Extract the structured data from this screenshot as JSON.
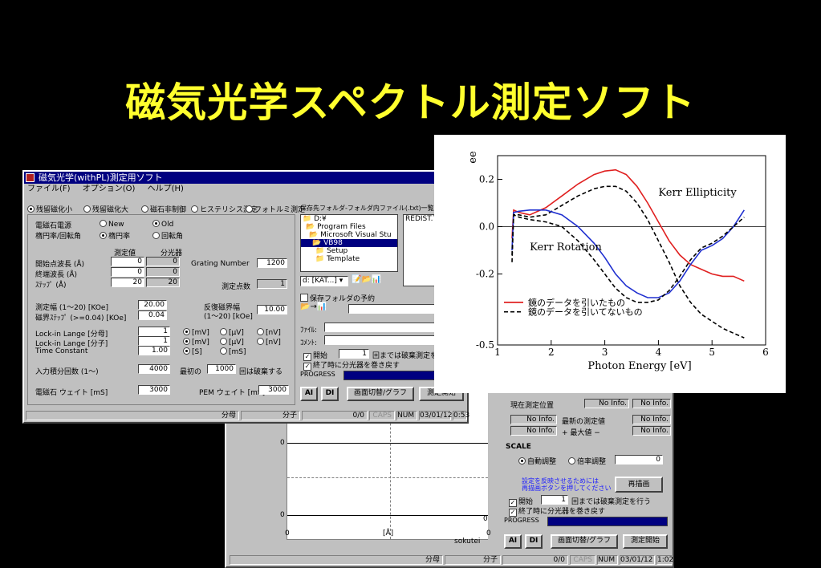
{
  "slide_title": "磁気光学スペクトル測定ソフト",
  "main_window": {
    "title": "磁気光学(withPL)測定用ソフト",
    "close": "×",
    "menu": [
      "ファイル(F)",
      "オプション(O)",
      "ヘルプ(H)"
    ],
    "mode_radios": [
      "残留磁化小",
      "残留磁化大",
      "磁石非制御",
      "ヒステリシス測定",
      "フォトルミ測定"
    ],
    "magnet_label": "電磁石電源",
    "magnet_new": "New",
    "magnet_old": "Old",
    "ellip_label": "楕円率/回転角",
    "ellip_opt": "楕円率",
    "rot_opt": "回転角",
    "col_measured": "測定値",
    "col_spectro": "分光器",
    "start_wl_label": "開始点波長 (Å)",
    "start_wl": "0",
    "start_wl2": "0",
    "end_wl_label": "終端波長 (Å)",
    "end_wl": "0",
    "end_wl2": "0",
    "step_label": "ｽﾃｯﾌﾟ (Å)",
    "step": "20",
    "step2": "20",
    "grating_label": "Grating Number",
    "grating": "1200",
    "points_label": "測定点数",
    "points": "1",
    "width_label": "測定幅 (1～20) [KOe]",
    "width": "20.00",
    "field_step_label": "磁界ｽﾃｯﾌﾟ (>=0.04) [KOe]",
    "field_step": "0.04",
    "reverse_label": "反復磁界幅",
    "reverse_range": "(1～20) [kOe]",
    "reverse_val": "10.00",
    "lockin1_label": "Lock-in Lange [分母]",
    "lockin1": "1",
    "lockin2_label": "Lock-in Lange [分子]",
    "lockin2": "1",
    "tc_label": "Time Constant",
    "tc": "1.00",
    "unit_mv": "[mV]",
    "unit_uv": "[μV]",
    "unit_nv": "[nV]",
    "unit_s": "[S]",
    "unit_ms": "[mS]",
    "integ_label": "入力積分回数 (1～)",
    "integ": "4000",
    "first_label": "最初の",
    "first_val": "1000",
    "first_suffix": "回は破棄する",
    "wait_label": "電磁石 ウェイト [mS]",
    "wait": "3000",
    "pem_label": "PEM ウェイト [mS]",
    "pem": "3000",
    "folder_header": "保存先フォルダ-フォルダ内ファイル(.txt)一覧",
    "tree": [
      "D:¥",
      "Program Files",
      "Microsoft Visual Stu",
      "VB98",
      "Setup",
      "Template"
    ],
    "file_list": [
      "REDIST.TXT"
    ],
    "drive": "d: [KAT...]",
    "reserve_label": "保存フォルダの予約",
    "file_label": "ﾌｧｲﾙ:",
    "file_btn": "目",
    "comment_label": "ｺﾒﾝﾄ:",
    "begin_label": "開始",
    "begin_val": "1",
    "begin_suffix": "回までは破棄測定を行う",
    "return_label": "終了時に分光器を巻き戻す",
    "progress_label": "PROGRESS",
    "btn_ai": "AI",
    "btn_di": "DI",
    "btn_switch": "画面切替/グラフ",
    "btn_start": "測定開始",
    "status": [
      "分母",
      "分子",
      "0/0",
      "CAPS",
      "NUM",
      "03/01/12",
      "0:53"
    ]
  },
  "back_window": {
    "pos_label": "現在測定位置",
    "no_info": "No Info.",
    "latest_label": "最新の測定値",
    "max_label": "+ 最大値 −",
    "scale_label": "SCALE",
    "auto_label": "自動調整",
    "ratio_label": "倍率調整",
    "ratio_val": "0",
    "hint1": "設定を反映させるためには",
    "hint2": "再描画ボタンを押してください",
    "redraw": "再描画",
    "begin_label": "開始",
    "begin_val": "1",
    "begin_suffix": "回までは破棄測定を行う",
    "return_label": "終了時に分光器を巻き戻す",
    "progress_label": "PROGRESS",
    "btn_ai": "AI",
    "btn_di": "DI",
    "btn_switch": "画面切替/グラフ",
    "btn_start": "測定開始",
    "y_zero_top": "0",
    "y_zero_bottom": "0",
    "x_left": "0",
    "x_unit": "[Å]",
    "right_zero": "0",
    "right_zero2": "0",
    "sokutei": "sokutei",
    "status": [
      "分母",
      "分子",
      "0/0",
      "CAPS",
      "NUM",
      "03/01/12",
      "1:02"
    ]
  },
  "chart_data": {
    "type": "line",
    "xlabel": "Photon Energy [eV]",
    "ylabel_fragment": "ee",
    "xlim": [
      1,
      6
    ],
    "ylim": [
      -0.5,
      0.3
    ],
    "x_ticks": [
      "1",
      "2",
      "3",
      "4",
      "5",
      "6"
    ],
    "y_ticks": [
      "0.2",
      "0.0",
      "-0.2",
      "-0.5"
    ],
    "annotations": [
      "Kerr Ellipticity",
      "Kerr Rotation"
    ],
    "legend": [
      "鏡のデータを引いたもの",
      "鏡のデータを引いてないもの"
    ],
    "colors": {
      "red": "#e02020",
      "blue": "#2030d0",
      "black": "#000000"
    },
    "series": [
      {
        "name": "ellipticity_subtracted",
        "style": "solid",
        "color": "#e02020",
        "x": [
          1.27,
          1.3,
          1.4,
          1.6,
          1.9,
          2.2,
          2.5,
          2.8,
          3.0,
          3.2,
          3.4,
          3.6,
          3.8,
          4.0,
          4.2,
          4.4,
          4.6,
          4.8,
          5.0,
          5.2,
          5.4,
          5.6
        ],
        "y": [
          -0.05,
          0.07,
          0.06,
          0.05,
          0.08,
          0.13,
          0.18,
          0.22,
          0.235,
          0.24,
          0.22,
          0.17,
          0.1,
          0.02,
          -0.06,
          -0.12,
          -0.16,
          -0.18,
          -0.2,
          -0.21,
          -0.21,
          -0.23
        ]
      },
      {
        "name": "ellipticity_raw",
        "style": "dashed",
        "color": "#000000",
        "x": [
          1.27,
          1.3,
          1.4,
          1.6,
          1.9,
          2.2,
          2.5,
          2.8,
          3.0,
          3.2,
          3.4,
          3.6,
          3.8,
          4.0,
          4.2,
          4.4,
          4.6,
          4.8,
          5.0,
          5.2,
          5.4,
          5.6
        ],
        "y": [
          -0.15,
          0.05,
          0.05,
          0.04,
          0.05,
          0.09,
          0.13,
          0.16,
          0.17,
          0.17,
          0.15,
          0.1,
          0.03,
          -0.06,
          -0.15,
          -0.25,
          -0.32,
          -0.37,
          -0.4,
          -0.43,
          -0.45,
          -0.47
        ]
      },
      {
        "name": "rotation_subtracted",
        "style": "solid",
        "color": "#2030d0",
        "x": [
          1.27,
          1.3,
          1.4,
          1.6,
          1.9,
          2.2,
          2.5,
          2.8,
          3.0,
          3.2,
          3.4,
          3.6,
          3.8,
          4.0,
          4.2,
          4.4,
          4.6,
          4.8,
          5.0,
          5.2,
          5.4,
          5.6
        ],
        "y": [
          -0.1,
          0.06,
          0.065,
          0.07,
          0.07,
          0.05,
          0.0,
          -0.07,
          -0.13,
          -0.2,
          -0.25,
          -0.28,
          -0.3,
          -0.3,
          -0.28,
          -0.23,
          -0.16,
          -0.1,
          -0.08,
          -0.05,
          0.0,
          0.07
        ]
      },
      {
        "name": "rotation_raw",
        "style": "dashed",
        "color": "#000000",
        "x": [
          1.27,
          1.3,
          1.4,
          1.6,
          1.9,
          2.2,
          2.5,
          2.8,
          3.0,
          3.2,
          3.4,
          3.6,
          3.8,
          4.0,
          4.2,
          4.4,
          4.6,
          4.8,
          5.0,
          5.2,
          5.4,
          5.6
        ],
        "y": [
          -0.12,
          0.05,
          0.04,
          0.03,
          0.02,
          0.0,
          -0.06,
          -0.14,
          -0.2,
          -0.26,
          -0.3,
          -0.32,
          -0.32,
          -0.31,
          -0.27,
          -0.21,
          -0.14,
          -0.09,
          -0.07,
          -0.04,
          0.0,
          0.04
        ]
      }
    ]
  }
}
